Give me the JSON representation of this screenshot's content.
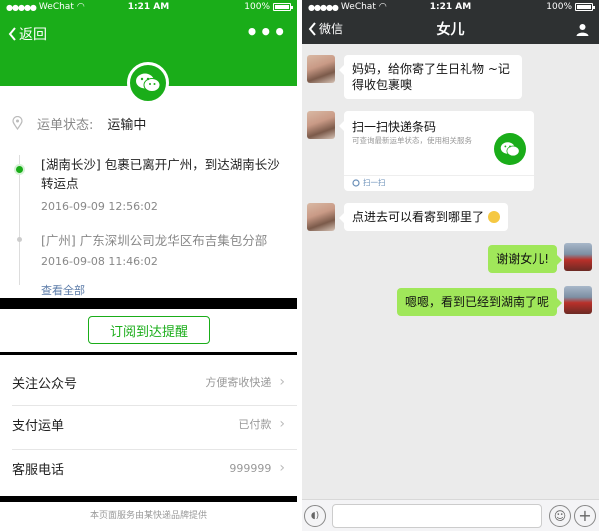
{
  "colors": {
    "wechat_green": "#1aad19",
    "bubble_green": "#a0e75a",
    "nav_dark": "#2e3132",
    "chat_bg": "#ebebeb"
  },
  "left": {
    "status": {
      "carrier": "WeChat",
      "time": "1:21 AM",
      "battery": "100%"
    },
    "nav": {
      "back_label": "返回",
      "more_label": "•••"
    },
    "logo_icon": "wechat-logo-icon",
    "status_row": {
      "label": "运单状态:",
      "value": "运输中"
    },
    "timeline": [
      {
        "text": "[湖南长沙] 包裹已离开广州，到达湖南长沙转运点",
        "time": "2016-09-09 12:56:02"
      },
      {
        "text": "[广州] 广东深圳公司龙华区布吉集包分部",
        "time": "2016-09-08 11:46:02"
      }
    ],
    "see_all": "查看全部",
    "subscribe_label": "订阅到达提醒",
    "rows": [
      {
        "key": "关注公众号",
        "value": "方便寄收快递"
      },
      {
        "key": "支付运单",
        "value": "已付款"
      },
      {
        "key": "客服电话",
        "value": "999999"
      }
    ],
    "footer": "本页面服务由某快递品牌提供"
  },
  "right": {
    "status": {
      "carrier": "WeChat",
      "time": "1:21 AM",
      "battery": "100%"
    },
    "nav": {
      "back_label": "微信",
      "title": "女儿"
    },
    "messages": {
      "m1": "妈妈，给你寄了生日礼物 ~记得收包裹噢",
      "card": {
        "title": "扫一扫快递条码",
        "desc": "可查询最新运单状态，使用相关服务",
        "footer": "扫一扫"
      },
      "m3": "点进去可以看寄到哪里了",
      "m4": "谢谢女儿!",
      "m5": "嗯嗯，看到已经到湖南了呢"
    }
  }
}
